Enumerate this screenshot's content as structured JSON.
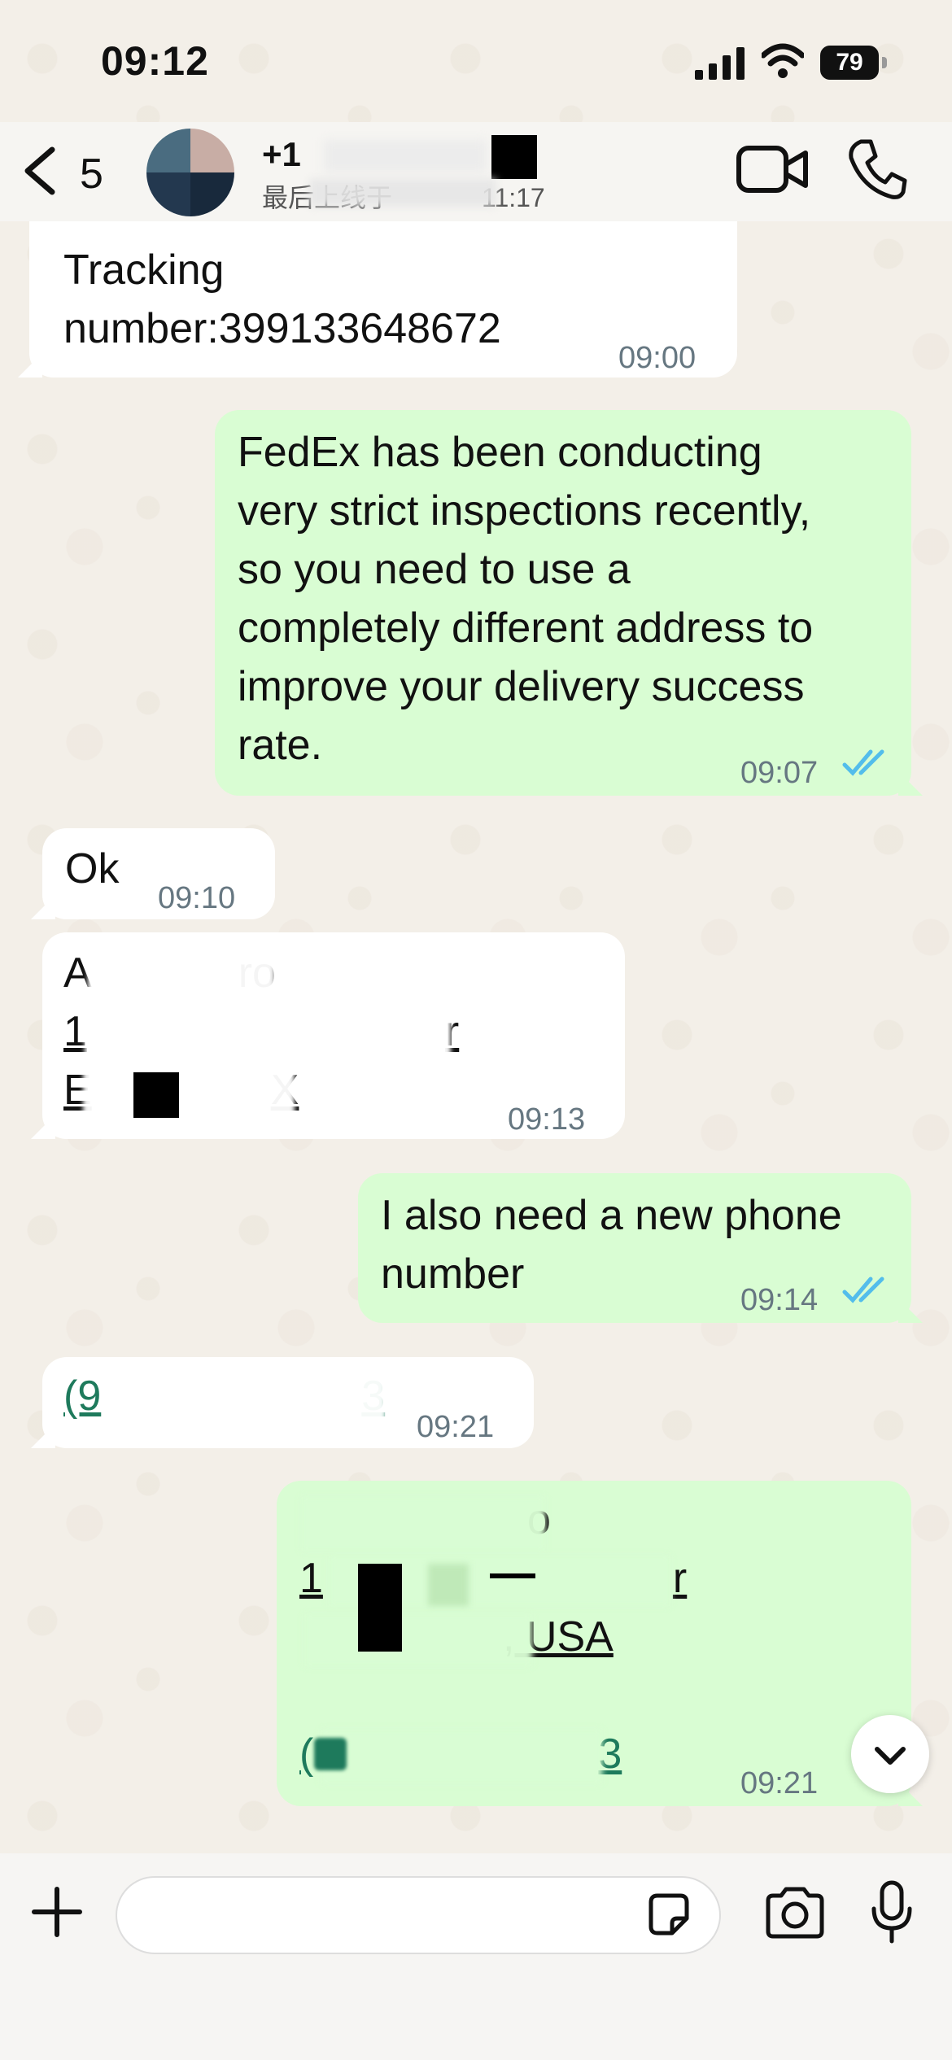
{
  "status_bar": {
    "time": "09:12",
    "battery": "79"
  },
  "header": {
    "back_count": "5",
    "contact_name_visible": "+1",
    "last_seen_visible": "最后上线于",
    "last_seen_time_visible": "11:17"
  },
  "messages": [
    {
      "side": "in",
      "text": "Tracking\nnumber:399133648672",
      "time": "09:00"
    },
    {
      "side": "out",
      "text": "FedEx has been conducting\nvery strict inspections recently,\nso you need to use a\ncompletely different address to\nimprove your delivery success\nrate.",
      "time": "09:07",
      "read": true
    },
    {
      "side": "in",
      "text": "Ok",
      "time": "09:10"
    },
    {
      "side": "in",
      "lines": [
        "A",
        "ro",
        "1",
        "r",
        "E",
        "X"
      ],
      "time": "09:13"
    },
    {
      "side": "out",
      "text": "I also need a new phone\nnumber",
      "time": "09:14",
      "read": true
    },
    {
      "side": "in",
      "lines": [
        "(9",
        "3"
      ],
      "time": "09:21"
    },
    {
      "side": "out",
      "lines": [
        "o",
        "1",
        "r",
        ", USA",
        "(",
        "3"
      ],
      "time": "09:21",
      "read": true
    }
  ],
  "input": {
    "placeholder": ""
  },
  "colors": {
    "incoming": "#ffffff",
    "outgoing": "#d9fdd3",
    "ticks": "#53bdeb",
    "link": "#1e7a5c"
  }
}
